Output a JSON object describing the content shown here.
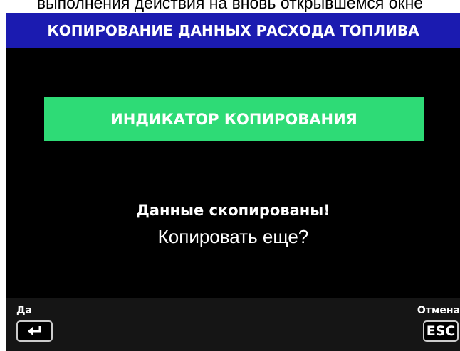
{
  "caption": "выполнения действия на вновь открывшемся окне",
  "header": {
    "title": "КОПИРОВАНИЕ ДАННЫХ РАСХОДА ТОПЛИВА"
  },
  "indicator": {
    "label": "ИНДИКАТОР КОПИРОВАНИЯ"
  },
  "message": {
    "line1": "Данные скопированы!",
    "line2": "Копировать еще?"
  },
  "footer": {
    "yes_label": "Да",
    "cancel_label": "Отмена",
    "yes_key_icon": "enter-icon",
    "esc_key_text": "ESC"
  },
  "colors": {
    "header_bg": "#1b1bb0",
    "indicator_bg": "#2edb76",
    "screen_bg": "#000000",
    "footer_bg": "#151515"
  }
}
